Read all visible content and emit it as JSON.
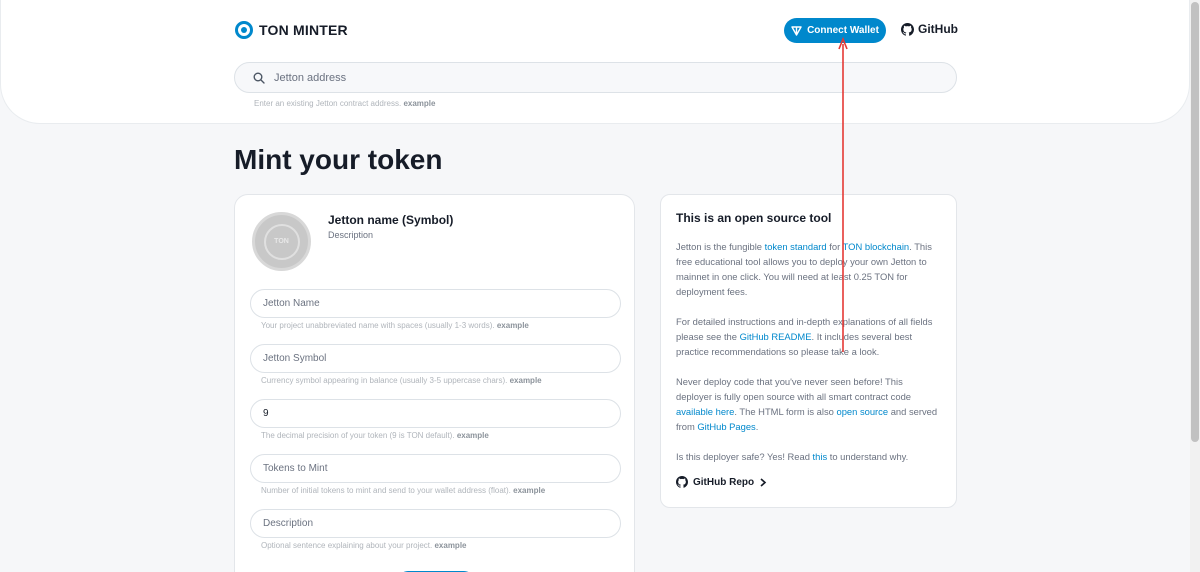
{
  "header": {
    "logo_text": "TON MINTER",
    "connect_label": "Connect Wallet",
    "github_label": "GitHub",
    "accent": "#0088cc"
  },
  "search": {
    "placeholder": "Jetton address",
    "hint_text": "Enter an existing Jetton contract address.",
    "hint_example": "example"
  },
  "page_title": "Mint your token",
  "form": {
    "jetton_title": "Jetton name (Symbol)",
    "jetton_desc": "Description",
    "avatar_label": "TON",
    "fields": [
      {
        "placeholder": "Jetton Name",
        "value": "",
        "hint": "Your project unabbreviated name with spaces (usually 1-3 words).",
        "example": "example"
      },
      {
        "placeholder": "Jetton Symbol",
        "value": "",
        "hint": "Currency symbol appearing in balance (usually 3-5 uppercase chars).",
        "example": "example"
      },
      {
        "placeholder": "",
        "value": "9",
        "hint": "The decimal precision of your token (9 is TON default).",
        "example": "example"
      },
      {
        "placeholder": "Tokens to Mint",
        "value": "",
        "hint": "Number of initial tokens to mint and send to your wallet address (float).",
        "example": "example"
      },
      {
        "placeholder": "Description",
        "value": "",
        "hint": "Optional sentence explaining about your project.",
        "example": "example"
      }
    ]
  },
  "info": {
    "title": "This is an open source tool",
    "p1": {
      "a": "Jetton is the fungible ",
      "link1": "token standard",
      "b": " for ",
      "link2": "TON blockchain",
      "c": ". This free educational tool allows you to deploy your own Jetton to mainnet in one click. You will need at least 0.25 TON for deployment fees."
    },
    "p2": {
      "a": "For detailed instructions and in-depth explanations of all fields please see the ",
      "link1": "GitHub README",
      "b": ". It includes several best practice recommendations so please take a look."
    },
    "p3": {
      "a": "Never deploy code that you've never seen before! This deployer is fully open source with all smart contract code ",
      "link1": "available here",
      "b": ". The HTML form is also ",
      "link2": "open source",
      "c": " and served from ",
      "link3": "GitHub Pages",
      "d": "."
    },
    "p4": {
      "a": "Is this deployer safe? Yes! Read ",
      "link1": "this",
      "b": " to understand why."
    },
    "repo_label": "GitHub Repo"
  }
}
